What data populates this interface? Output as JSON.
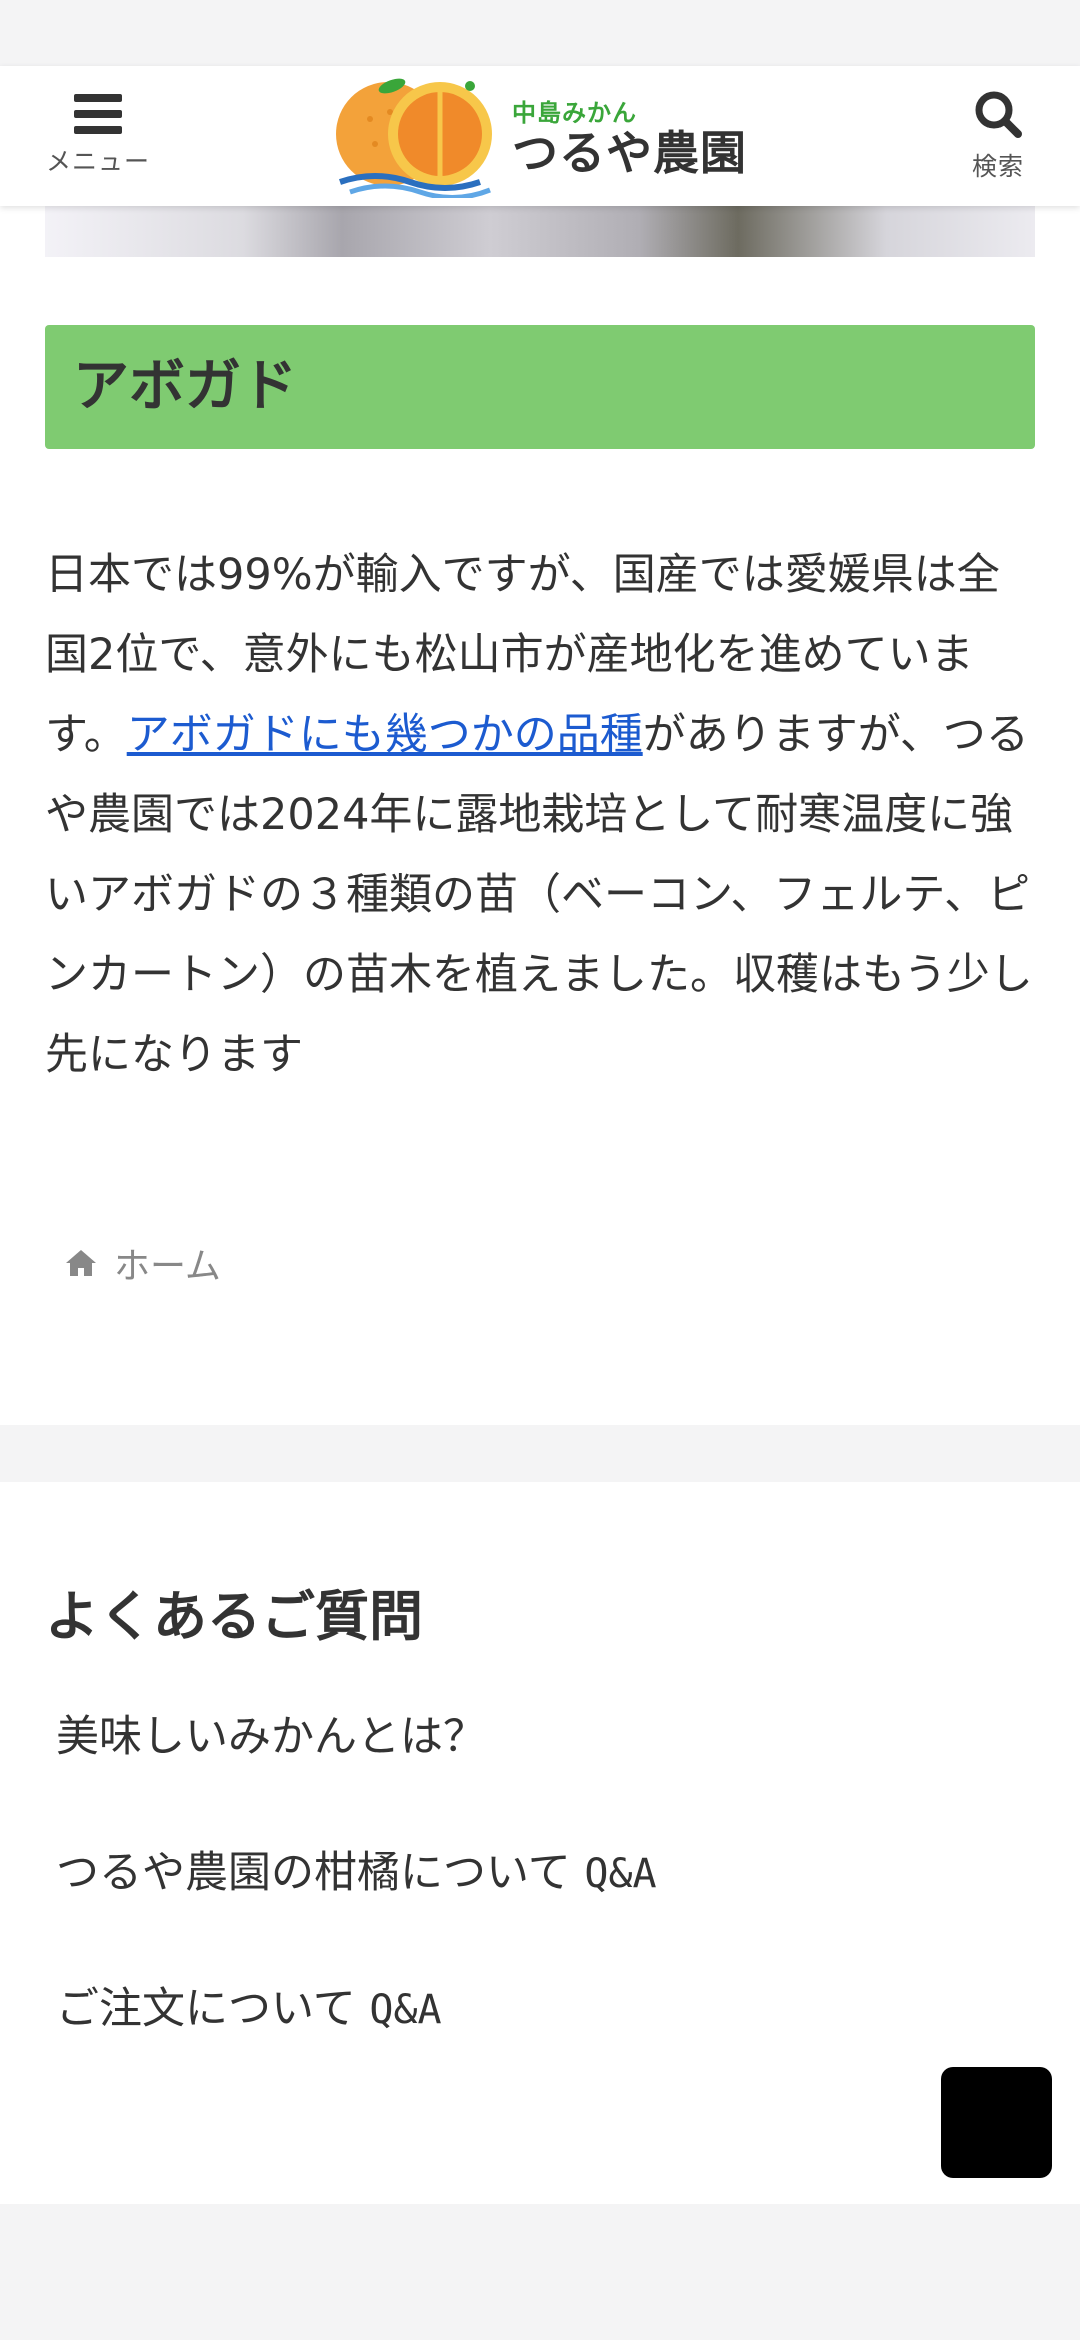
{
  "header": {
    "menu_label": "メニュー",
    "search_label": "検索",
    "logo_sub": "中島みかん",
    "logo_main": "つるや農園"
  },
  "article": {
    "section_title": "アボガド",
    "paragraph": {
      "before_link": "日本では99%が輸入ですが、国産では愛媛県は全国2位で、意外にも松山市が産地化を進めています。",
      "link_text": "アボガドにも幾つかの品種",
      "after_link": "がありますが、つるや農園では2024年に露地栽培として耐寒温度に強いアボガドの３種類の苗（ベーコン、フェルテ、ピンカートン）の苗木を植えました。収穫はもう少し先になります"
    },
    "breadcrumb_home": "ホーム"
  },
  "faq": {
    "title": "よくあるご質問",
    "items": [
      {
        "text": "美味しいみかんとは？",
        "suffix": ""
      },
      {
        "text": "つるや農園の柑橘について ",
        "suffix": "Q&A"
      },
      {
        "text": "ご注文について ",
        "suffix": "Q&A"
      }
    ]
  },
  "colors": {
    "section_head_bg": "#7fcb71",
    "link": "#1c5bd0",
    "page_bg": "#f4f4f5",
    "logo_green": "#3aa63a",
    "orange": "#f0a030"
  },
  "icons": {
    "menu": "hamburger-icon",
    "search": "search-icon",
    "home": "home-icon",
    "logo": "orange-logo-icon"
  }
}
